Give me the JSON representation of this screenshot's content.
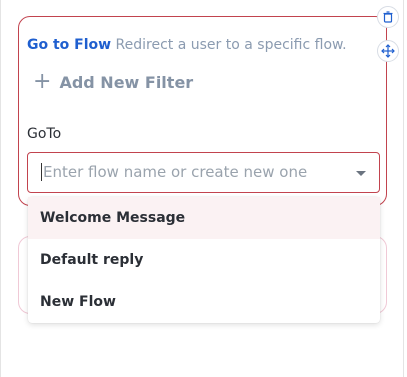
{
  "node": {
    "title": "Go to Flow",
    "description": "Redirect a user to a specific flow."
  },
  "filter": {
    "add_label": "Add New Filter",
    "plus_glyph": "+"
  },
  "goto": {
    "label": "GoTo",
    "placeholder": "Enter flow name or create new one"
  },
  "dropdown": {
    "options": [
      "Welcome Message",
      "Default reply",
      "New Flow"
    ],
    "highlighted_index": 0
  },
  "icons": {
    "delete": "trash-icon",
    "move": "move-arrows-icon",
    "dropdown": "caret-down-icon"
  },
  "colors": {
    "accent_blue": "#1f5fcf",
    "error_border": "#c2434e",
    "muted_text": "#8b9bb0"
  }
}
